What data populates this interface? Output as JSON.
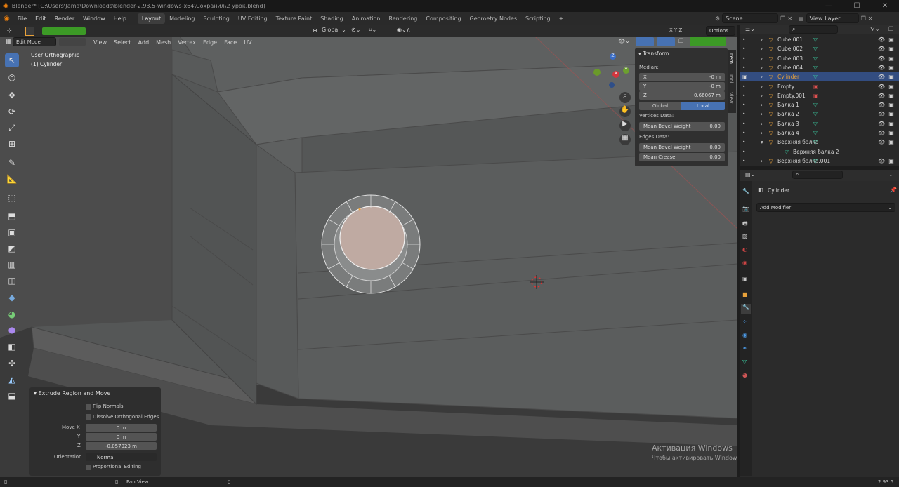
{
  "window": {
    "title": "Blender* [C:\\Users\\Jama\\Downloads\\blender-2.93.5-windows-x64\\Сохранил\\2 урок.blend]",
    "min": "—",
    "max": "☐",
    "close": "✕"
  },
  "menu": {
    "items": [
      "File",
      "Edit",
      "Render",
      "Window",
      "Help"
    ]
  },
  "workspaces": [
    {
      "label": "Layout",
      "active": true
    },
    {
      "label": "Modeling"
    },
    {
      "label": "Sculpting"
    },
    {
      "label": "UV Editing"
    },
    {
      "label": "Texture Paint"
    },
    {
      "label": "Shading"
    },
    {
      "label": "Animation"
    },
    {
      "label": "Rendering"
    },
    {
      "label": "Compositing"
    },
    {
      "label": "Geometry Nodes"
    },
    {
      "label": "Scripting"
    }
  ],
  "add_workspace": "+",
  "scene": {
    "label": "Scene"
  },
  "view_layer": {
    "label": "View Layer"
  },
  "viewport_header": {
    "mode": "Edit Mode",
    "menus": [
      "View",
      "Select",
      "Add",
      "Mesh",
      "Vertex",
      "Edge",
      "Face",
      "UV"
    ],
    "orientation": "Global",
    "options": "Options",
    "axes": [
      "X",
      "Y",
      "Z"
    ]
  },
  "viewport": {
    "view_name": "User Orthographic",
    "object_name": "(1) Cylinder"
  },
  "side_tabs": [
    "Item",
    "Tool",
    "View"
  ],
  "transform_panel": {
    "title": "Transform",
    "median_label": "Median:",
    "x_label": "X",
    "x_value": "-0 m",
    "y_label": "Y",
    "y_value": "-0 m",
    "z_label": "Z",
    "z_value": "0.66067 m",
    "global": "Global",
    "local": "Local",
    "vertices_label": "Vertices Data:",
    "v_bevel_label": "Mean Bevel Weight",
    "v_bevel_value": "0.00",
    "edges_label": "Edges Data:",
    "e_bevel_label": "Mean Bevel Weight",
    "e_bevel_value": "0.00",
    "crease_label": "Mean Crease",
    "crease_value": "0.00"
  },
  "outliner": {
    "items": [
      {
        "name": "Cube.001",
        "type": "mesh"
      },
      {
        "name": "Cube.002",
        "type": "mesh"
      },
      {
        "name": "Cube.003",
        "type": "mesh"
      },
      {
        "name": "Cube.004",
        "type": "mesh"
      },
      {
        "name": "Cylinder",
        "type": "mesh",
        "selected": true
      },
      {
        "name": "Empty",
        "type": "empty"
      },
      {
        "name": "Empty.001",
        "type": "empty"
      },
      {
        "name": "Балка 1",
        "type": "mesh"
      },
      {
        "name": "Балка 2",
        "type": "mesh"
      },
      {
        "name": "Балка 3",
        "type": "mesh"
      },
      {
        "name": "Балка 4",
        "type": "mesh"
      },
      {
        "name": "Верхняя балка",
        "type": "mesh",
        "expanded": true
      },
      {
        "name": "Верхняя балка 2",
        "type": "child"
      },
      {
        "name": "Верхняя балка.001",
        "type": "mesh"
      }
    ]
  },
  "properties": {
    "object": "Cylinder",
    "add_modifier": "Add Modifier"
  },
  "operator_panel": {
    "title": "Extrude Region and Move",
    "flip_normals": "Flip Normals",
    "dissolve": "Dissolve Orthogonal Edges",
    "move_x_label": "Move X",
    "move_x": "0 m",
    "y_label": "Y",
    "y": "0 m",
    "z_label": "Z",
    "z": "-0.057923 m",
    "orientation_label": "Orientation",
    "orientation": "Normal",
    "proportional": "Proportional Editing"
  },
  "watermark": {
    "title": "Активация Windows",
    "subtitle": "Чтобы активировать Windows, перейдите в раздел \"Параметры\"."
  },
  "status": {
    "pan": "Pan View",
    "version": "2.93.5"
  },
  "colors": {
    "accent": "#4772b3",
    "selected_row": "#334d80",
    "mesh_icon": "#e8a13a",
    "vgroup": "#3ac9a0"
  }
}
